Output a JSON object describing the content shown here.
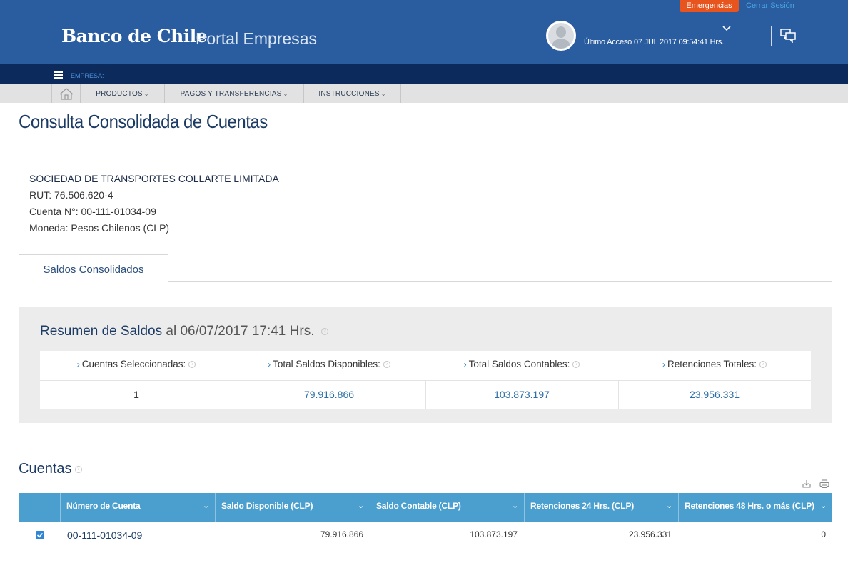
{
  "header": {
    "brand_logo": "Banco de Chile",
    "brand_portal": "Portal Empresas",
    "emergencias_label": "Emergencias",
    "cerrar_sesion_label": "Cerrar Sesión",
    "last_access": "Último Acceso 07 JUL 2017 09:54:41 Hrs.",
    "empresa_label": "EMPRESA:",
    "colors": {
      "topbar": "#2a5ca0",
      "empresa_bar": "#0d2a5c",
      "emergencias": "#e8541e"
    }
  },
  "menu": {
    "items": [
      {
        "label": "PRODUCTOS"
      },
      {
        "label": "PAGOS Y TRANSFERENCIAS"
      },
      {
        "label": "INSTRUCCIONES"
      }
    ],
    "caret": "⌄"
  },
  "page": {
    "title": "Consulta Consolidada de Cuentas",
    "company": "SOCIEDAD DE TRANSPORTES COLLARTE LIMITADA",
    "rut": "RUT: 76.506.620-4",
    "cuenta": "Cuenta N°: 00-111-01034-09",
    "moneda": "Moneda: Pesos Chilenos (CLP)"
  },
  "tabs": [
    {
      "label": "Saldos Consolidados",
      "active": true
    }
  ],
  "summary": {
    "title": "Resumen de Saldos",
    "date_text": "al 06/07/2017 17:41 Hrs.",
    "headers": [
      "Cuentas Seleccionadas:",
      "Total Saldos Disponibles:",
      "Total Saldos Contables:",
      "Retenciones Totales:"
    ],
    "values": [
      "1",
      "79.916.866",
      "103.873.197",
      "23.956.331"
    ]
  },
  "accounts": {
    "title": "Cuentas",
    "columns": [
      "Número de Cuenta",
      "Saldo Disponible (CLP)",
      "Saldo Contable (CLP)",
      "Retenciones 24 Hrs. (CLP)",
      "Retenciones 48 Hrs. o más (CLP)"
    ],
    "rows": [
      {
        "selected": true,
        "cells": [
          "00-111-01034-09",
          "79.916.866",
          "103.873.197",
          "23.956.331",
          "0"
        ]
      }
    ]
  }
}
